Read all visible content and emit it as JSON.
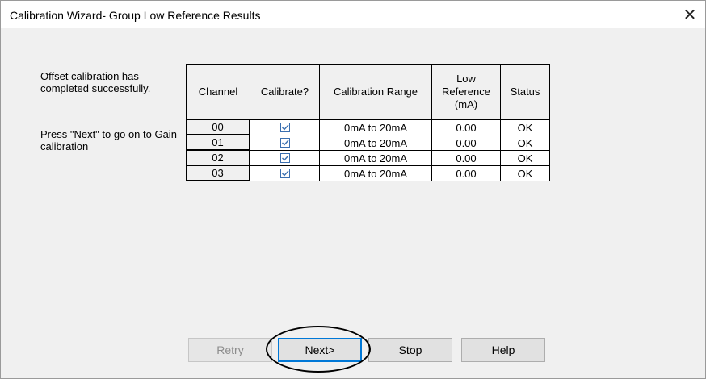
{
  "window": {
    "title": "Calibration Wizard- Group Low Reference Results",
    "close_glyph": "✕"
  },
  "messages": {
    "line1": "Offset calibration has completed successfully.",
    "line2": "Press \"Next\" to go on to Gain calibration"
  },
  "table": {
    "headers": {
      "channel": "Channel",
      "calibrate": "Calibrate?",
      "range": "Calibration Range",
      "low_ref": [
        "Low",
        "Reference",
        "(mA)"
      ],
      "status": "Status"
    },
    "rows": [
      {
        "channel": "00",
        "calibrate": true,
        "range": "0mA to 20mA",
        "low_ref": "0.00",
        "status": "OK"
      },
      {
        "channel": "01",
        "calibrate": true,
        "range": "0mA to 20mA",
        "low_ref": "0.00",
        "status": "OK"
      },
      {
        "channel": "02",
        "calibrate": true,
        "range": "0mA to 20mA",
        "low_ref": "0.00",
        "status": "OK"
      },
      {
        "channel": "03",
        "calibrate": true,
        "range": "0mA to 20mA",
        "low_ref": "0.00",
        "status": "OK"
      }
    ]
  },
  "buttons": {
    "retry": "Retry",
    "next": "Next>",
    "stop": "Stop",
    "help": "Help"
  },
  "colors": {
    "checkbox_border": "#3a6fb0",
    "checkmark": "#3a6fb0",
    "default_button_border": "#0078d7"
  }
}
